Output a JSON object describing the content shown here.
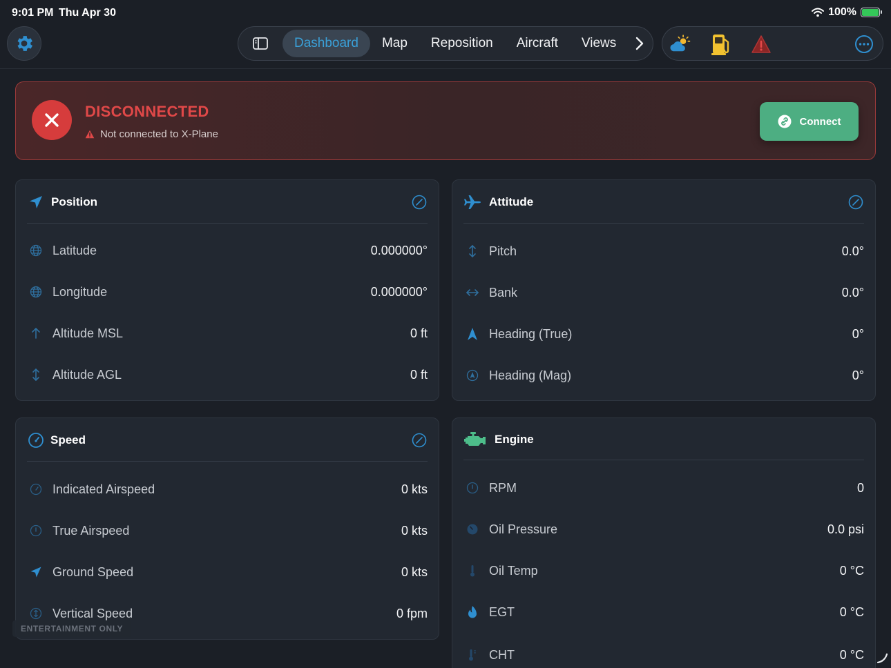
{
  "status_bar": {
    "time": "9:01 PM",
    "date": "Thu Apr 30",
    "battery": "100%"
  },
  "nav": {
    "tabs": [
      {
        "label": "Dashboard",
        "active": true
      },
      {
        "label": "Map"
      },
      {
        "label": "Reposition"
      },
      {
        "label": "Aircraft"
      },
      {
        "label": "Views"
      }
    ]
  },
  "icons": {
    "settings": "gear-icon",
    "sidebar": "sidebar-toggle-icon",
    "more_tabs": "chevron-right-icon",
    "weather": "weather-cloud-sun-icon",
    "fuel": "fuel-pump-icon",
    "warning": "warning-triangle-icon",
    "more": "ellipsis-circle-icon"
  },
  "banner": {
    "title": "DISCONNECTED",
    "subtitle": "Not connected to X-Plane",
    "connect_label": "Connect"
  },
  "position": {
    "title": "Position",
    "rows": [
      {
        "label": "Latitude",
        "value": "0.000000°"
      },
      {
        "label": "Longitude",
        "value": "0.000000°"
      },
      {
        "label": "Altitude MSL",
        "value": "0 ft"
      },
      {
        "label": "Altitude AGL",
        "value": "0 ft"
      }
    ]
  },
  "attitude": {
    "title": "Attitude",
    "rows": [
      {
        "label": "Pitch",
        "value": "0.0°"
      },
      {
        "label": "Bank",
        "value": "0.0°"
      },
      {
        "label": "Heading (True)",
        "value": "0°"
      },
      {
        "label": "Heading (Mag)",
        "value": "0°"
      }
    ]
  },
  "speed": {
    "title": "Speed",
    "rows": [
      {
        "label": "Indicated Airspeed",
        "value": "0 kts"
      },
      {
        "label": "True Airspeed",
        "value": "0 kts"
      },
      {
        "label": "Ground Speed",
        "value": "0 kts"
      },
      {
        "label": "Vertical Speed",
        "value": "0 fpm"
      }
    ]
  },
  "engine": {
    "title": "Engine",
    "rows": [
      {
        "label": "RPM",
        "value": "0"
      },
      {
        "label": "Oil Pressure",
        "value": "0.0 psi"
      },
      {
        "label": "Oil Temp",
        "value": "0 °C"
      },
      {
        "label": "EGT",
        "value": "0 °C"
      },
      {
        "label": "CHT",
        "value": "0 °C"
      }
    ]
  },
  "watermark": "ENTERTAINMENT ONLY",
  "colors": {
    "accent": "#3aa0d8",
    "danger": "#e04848",
    "success": "#4dae82",
    "engine": "#4dbd8a",
    "fuel": "#f2c230"
  }
}
